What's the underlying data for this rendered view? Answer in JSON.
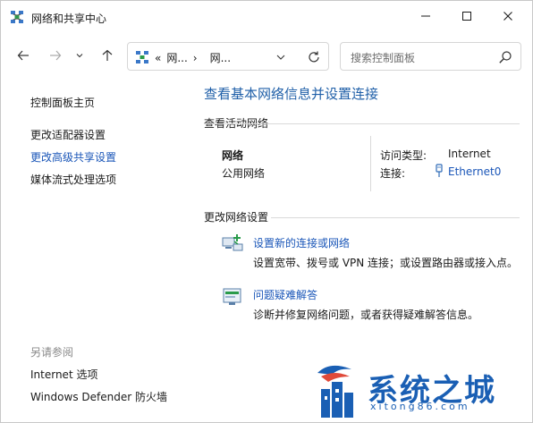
{
  "window": {
    "title": "网络和共享中心"
  },
  "nav": {
    "breadcrumb_root": "«",
    "breadcrumb_1": "网...",
    "breadcrumb_sep": "›",
    "breadcrumb_2": "网..."
  },
  "search": {
    "placeholder": "搜索控制面板"
  },
  "sidebar": {
    "items": [
      {
        "label": "控制面板主页"
      },
      {
        "label": "更改适配器设置"
      },
      {
        "label": "更改高级共享设置"
      },
      {
        "label": "媒体流式处理选项"
      }
    ],
    "see_also_label": "另请参阅",
    "see_also_items": [
      {
        "label": "Internet 选项"
      },
      {
        "label": "Windows Defender 防火墙"
      }
    ]
  },
  "main": {
    "title": "查看基本网络信息并设置连接",
    "active_section_label": "查看活动网络",
    "network_name": "网络",
    "network_type": "公用网络",
    "access_type_label": "访问类型:",
    "access_type_value": "Internet",
    "connection_label": "连接:",
    "connection_value": "Ethernet0",
    "change_section_label": "更改网络设置",
    "tasks": [
      {
        "link": "设置新的连接或网络",
        "desc": "设置宽带、拨号或 VPN 连接；或设置路由器或接入点。"
      },
      {
        "link": "问题疑难解答",
        "desc": "诊断并修复网络问题，或者获得疑难解答信息。"
      }
    ]
  },
  "watermark": {
    "brand": "系统之城",
    "url": "xitong86.com"
  },
  "colors": {
    "link": "#1a56b8",
    "title_blue": "#1f5fa8",
    "watermark_blue": "#1a5fb4"
  },
  "icons": [
    "network-center-icon",
    "minimize-icon",
    "maximize-icon",
    "close-icon",
    "back-arrow-icon",
    "forward-arrow-icon",
    "recent-locations-icon",
    "up-arrow-icon",
    "address-network-icon",
    "dropdown-chevron-icon",
    "refresh-icon",
    "search-icon",
    "ethernet-icon",
    "new-connection-icon",
    "troubleshoot-icon",
    "watermark-logo-icon"
  ]
}
